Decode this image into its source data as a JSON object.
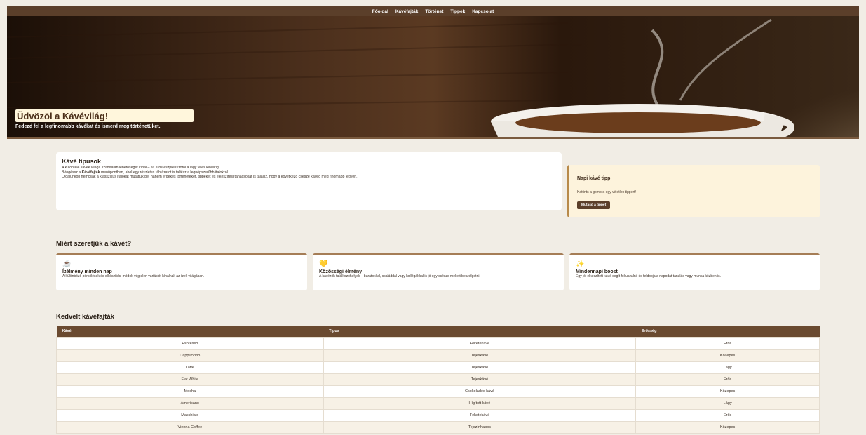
{
  "nav": {
    "items": [
      "Főoldal",
      "Kávéfajták",
      "Történet",
      "Tippek",
      "Kapcsolat"
    ]
  },
  "hero": {
    "title": "Üdvözöl a Kávévilág!",
    "subtitle": "Fedezd fel a legfinomabb kávékat és ismerd meg történetüket."
  },
  "intro": {
    "title": "Kávé típusok",
    "line1": "A különféle kávék világa számtalan lehetőséget kínál – az erős eszpresszótól a lágy tejes kávékig.",
    "line2_pre": "Böngéssz a ",
    "line2_bold": "Kávéfajták",
    "line2_post": " menüpontban, ahol egy részletes táblázatot is találsz a legnépszerűbb italokról.",
    "line3": "Oldalunkon nemcsak a klasszikus italokat mutatjuk be, hanem érdekes történeteket, tippeket és elkészítési tanácsokat is találsz, hogy a következő csésze kávéd még finomabb legyen."
  },
  "tip": {
    "title": "Napi kávé tipp",
    "text": "Kattints a gombra egy véletlen tippért!",
    "button": "Mutasd a tippet"
  },
  "why": {
    "title": "Miért szeretjük a kávét?",
    "cards": [
      {
        "icon": "coffee-cup-icon",
        "glyph": "☕",
        "title": "Ízélmény minden nap",
        "text": "A különböző pörkölések és elkészítési módok végtelen variációt kínálnak az ízek világában."
      },
      {
        "icon": "heart-icon",
        "glyph": "💛",
        "title": "Közösségi élmény",
        "text": "A kávézók találkozóhelyek – barátokkal, családdal vagy kollégákkal is jó egy csésze mellett beszélgetni."
      },
      {
        "icon": "sparkle-icon",
        "glyph": "✨",
        "title": "Mindennapi boost",
        "text": "Egy jól elkészített kávé segít fókuszálni, és feldobja a napodat tanulás vagy munka közben is."
      }
    ]
  },
  "favorites": {
    "title": "Kedvelt kávéfajták",
    "headers": [
      "Kávé",
      "Típus",
      "Erősség"
    ],
    "rows": [
      [
        "Espresso",
        "Feketekávé",
        "Erős"
      ],
      [
        "Cappuccino",
        "Tejeskávé",
        "Közepes"
      ],
      [
        "Latte",
        "Tejeskávé",
        "Lágy"
      ],
      [
        "Flat White",
        "Tejeskávé",
        "Erős"
      ],
      [
        "Mocha",
        "Csokoládés kávé",
        "Közepes"
      ],
      [
        "Americano",
        "Hígított kávé",
        "Lágy"
      ],
      [
        "Macchiato",
        "Feketekávé",
        "Erős"
      ],
      [
        "Vienna Coffee",
        "Tejszínhabos",
        "Közepes"
      ]
    ]
  }
}
